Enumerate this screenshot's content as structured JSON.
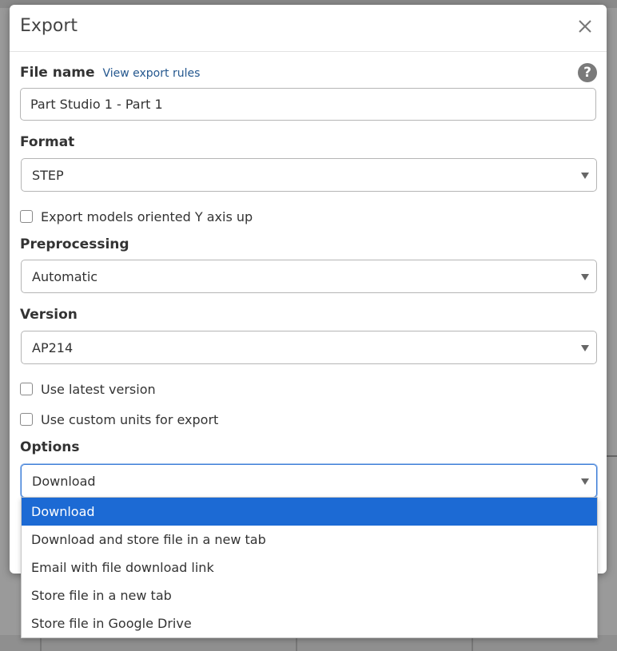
{
  "dialog": {
    "title": "Export",
    "file_name": {
      "label": "File name",
      "link": "View export rules",
      "value": "Part Studio 1 - Part 1"
    },
    "format": {
      "label": "Format",
      "value": "STEP"
    },
    "y_axis_checkbox": {
      "label": "Export models oriented Y axis up",
      "checked": false
    },
    "preprocessing": {
      "label": "Preprocessing",
      "value": "Automatic"
    },
    "version": {
      "label": "Version",
      "value": "AP214"
    },
    "latest_version_checkbox": {
      "label": "Use latest version",
      "checked": false
    },
    "custom_units_checkbox": {
      "label": "Use custom units for export",
      "checked": false
    },
    "options": {
      "label": "Options",
      "value": "Download",
      "items": [
        "Download",
        "Download and store file in a new tab",
        "Email with file download link",
        "Store file in a new tab",
        "Store file in Google Drive"
      ]
    }
  },
  "colors": {
    "selected_option": "#1c6ad4",
    "link": "#24578e",
    "focus_border": "#3c7cd6"
  }
}
